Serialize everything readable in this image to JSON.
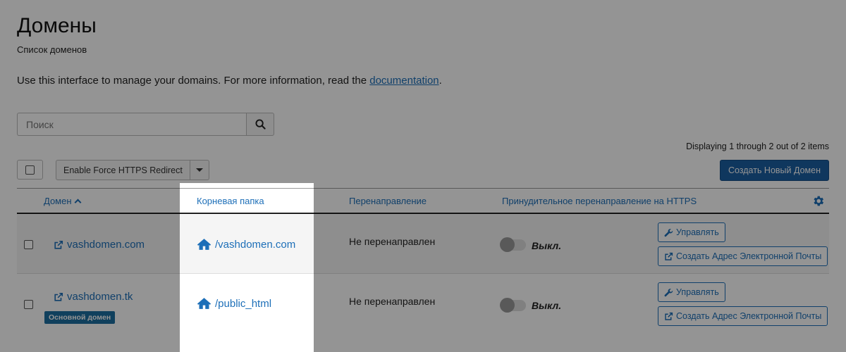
{
  "page": {
    "title": "Домены",
    "subtitle": "Список доменов",
    "intro_text": "Use this interface to manage your domains. For more information, read the ",
    "intro_link": "documentation",
    "intro_end": "."
  },
  "search": {
    "placeholder": "Поиск",
    "icon": "search-icon"
  },
  "toolbar": {
    "displaying": "Displaying 1 through 2 out of 2 items",
    "bulk_action_label": "Enable Force HTTPS Redirect",
    "create_label": "Создать Новый Домен"
  },
  "table": {
    "columns": {
      "domain": "Домен",
      "root": "Корневая папка",
      "redirect": "Перенаправление",
      "https": "Принудительное перенаправление на HTTPS"
    },
    "rows": [
      {
        "domain": "vashdomen.com",
        "root": "/vashdomen.com",
        "redirect": "Не перенаправлен",
        "https_state": "Выкл.",
        "manage_label": "Управлять",
        "email_label": "Создать Адрес Электронной Почты"
      },
      {
        "domain": "vashdomen.tk",
        "badge": "Основной домен",
        "root": "/public_html",
        "redirect": "Не перенаправлен",
        "https_state": "Выкл.",
        "manage_label": "Управлять",
        "email_label": "Создать Адрес Электронной Почты"
      }
    ]
  },
  "colors": {
    "accent": "#1d6fb8",
    "primary_button": "#1b5fa3",
    "badge": "#1d6fa0"
  }
}
